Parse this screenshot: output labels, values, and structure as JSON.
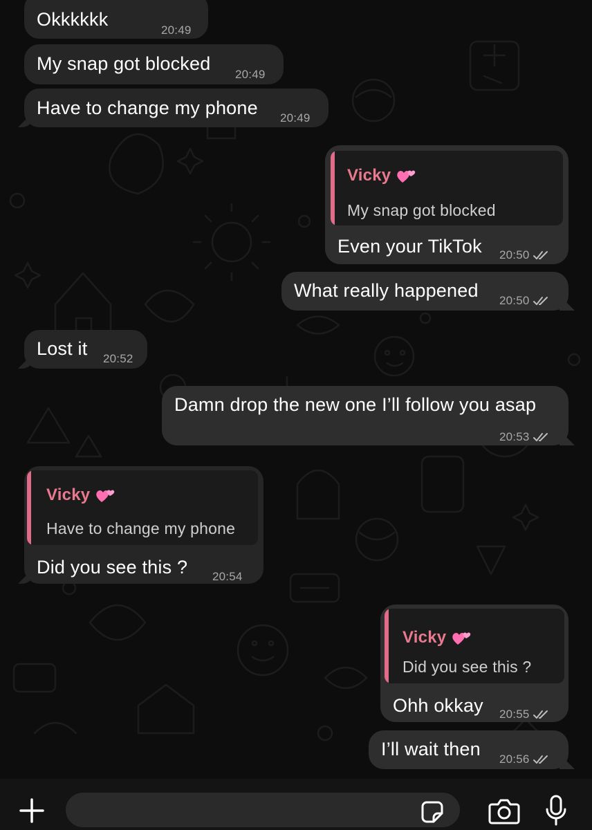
{
  "conversation": {
    "quoted_sender": "Vicky",
    "messages": [
      {
        "text": "Okkkkkk",
        "time": "20:49",
        "direction": "in"
      },
      {
        "text": "My snap got blocked",
        "time": "20:49",
        "direction": "in"
      },
      {
        "text": "Have to change my phone",
        "time": "20:49",
        "direction": "in"
      },
      {
        "text": "Even your TikTok",
        "time": "20:50",
        "direction": "out",
        "quote": "My snap got blocked",
        "status": "read"
      },
      {
        "text": "What really happened",
        "time": "20:50",
        "direction": "out",
        "status": "read"
      },
      {
        "text": "Lost it",
        "time": "20:52",
        "direction": "in"
      },
      {
        "text": "Damn drop the new one I’ll follow you asap",
        "time": "20:53",
        "direction": "out",
        "status": "read"
      },
      {
        "text": "Did you see this ?",
        "time": "20:54",
        "direction": "in",
        "quote": "Have to change my phone"
      },
      {
        "text": "Ohh okkay",
        "time": "20:55",
        "direction": "out",
        "quote": "Did you see this ?",
        "status": "read"
      },
      {
        "text": "I’ll wait then",
        "time": "20:56",
        "direction": "out",
        "status": "read"
      }
    ]
  },
  "composer": {
    "placeholder": "",
    "icons": [
      "plus-icon",
      "sticker-icon",
      "camera-icon",
      "microphone-icon"
    ]
  },
  "colors": {
    "quote_accent": "#e06c8a",
    "bubble": "#262626",
    "background": "#0d0d0d"
  }
}
